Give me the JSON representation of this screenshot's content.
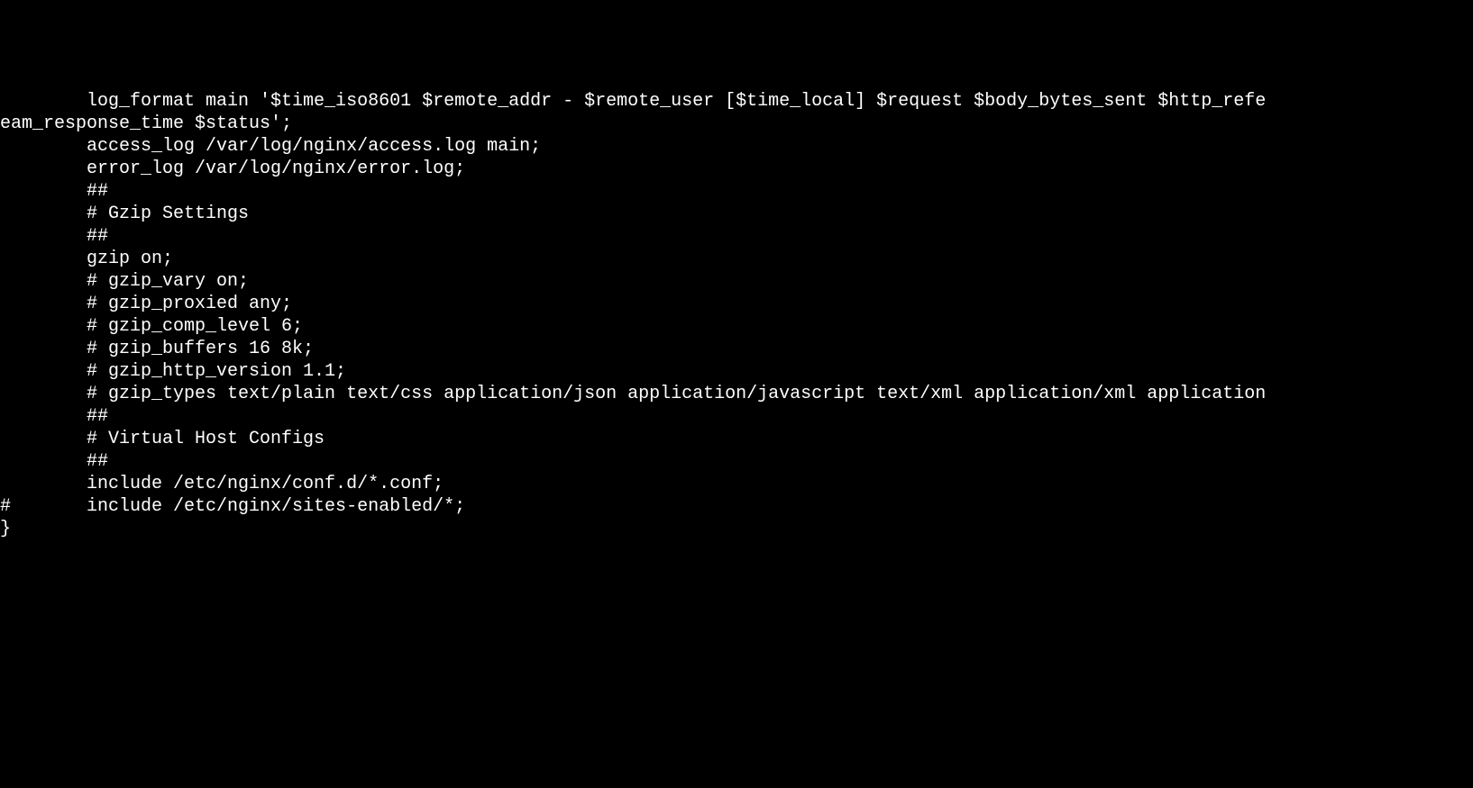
{
  "terminal": {
    "lines": [
      "        log_format main '$time_iso8601 $remote_addr - $remote_user [$time_local] $request $body_bytes_sent $http_refe",
      "eam_response_time $status';",
      "        access_log /var/log/nginx/access.log main;",
      "        error_log /var/log/nginx/error.log;",
      "        ##",
      "        # Gzip Settings",
      "        ##",
      "",
      "        gzip on;",
      "",
      "        # gzip_vary on;",
      "        # gzip_proxied any;",
      "        # gzip_comp_level 6;",
      "        # gzip_buffers 16 8k;",
      "        # gzip_http_version 1.1;",
      "        # gzip_types text/plain text/css application/json application/javascript text/xml application/xml application",
      "",
      "        ##",
      "        # Virtual Host Configs",
      "        ##",
      "",
      "        include /etc/nginx/conf.d/*.conf;",
      "#       include /etc/nginx/sites-enabled/*;",
      "}"
    ]
  }
}
